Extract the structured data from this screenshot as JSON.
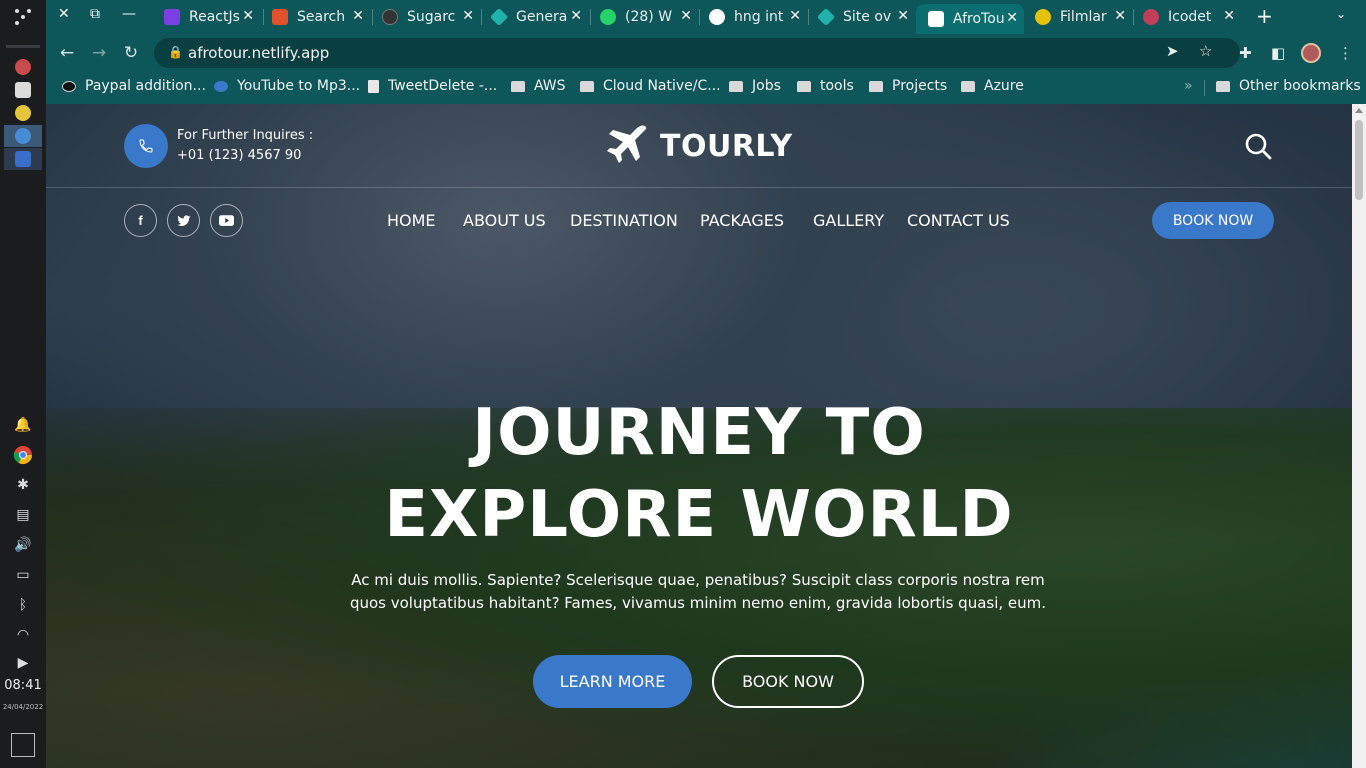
{
  "dock": {
    "time": "08:41",
    "date": "24/04/2022"
  },
  "browser": {
    "tabs": [
      {
        "title": "ReactJs",
        "favicon_color": "#7b3fe4"
      },
      {
        "title": "Search",
        "favicon_color": "#e0522b"
      },
      {
        "title": "Sugarc",
        "favicon_color": "#333333"
      },
      {
        "title": "Genera",
        "favicon_color": "#20b2aa"
      },
      {
        "title": "(28) W",
        "favicon_color": "#25d366"
      },
      {
        "title": "hng int",
        "favicon_color": "#ffffff"
      },
      {
        "title": "Site ov",
        "favicon_color": "#20b2aa"
      },
      {
        "title": "AfroTou",
        "favicon_color": "#ffffff"
      },
      {
        "title": "Filmlar",
        "favicon_color": "#e6c200"
      },
      {
        "title": "Icodet",
        "favicon_color": "#c0405a"
      }
    ],
    "url": "afrotour.netlify.app",
    "bookmarks": [
      "Paypal addition...",
      "YouTube to Mp3...",
      "TweetDelete -...",
      "AWS",
      "Cloud Native/C...",
      "Jobs",
      "tools",
      "Projects",
      "Azure"
    ],
    "other_bookmarks": "Other bookmarks"
  },
  "site": {
    "contact_label": "For Further Inquires :",
    "contact_phone": "+01 (123) 4567 90",
    "logo_text": "TOURLY",
    "nav": [
      "HOME",
      "ABOUT US",
      "DESTINATION",
      "PACKAGES",
      "GALLERY",
      "CONTACT US"
    ],
    "book_now": "BOOK NOW",
    "hero_title_line1": "JOURNEY TO",
    "hero_title_line2": "EXPLORE WORLD",
    "hero_text": "Ac mi duis mollis. Sapiente? Scelerisque quae, penatibus? Suscipit class corporis nostra rem quos voluptatibus habitant? Fames, vivamus minim nemo enim, gravida lobortis quasi, eum.",
    "learn_more": "LEARN MORE",
    "hero_book_now": "BOOK NOW",
    "accent_color": "#3a78c9"
  }
}
